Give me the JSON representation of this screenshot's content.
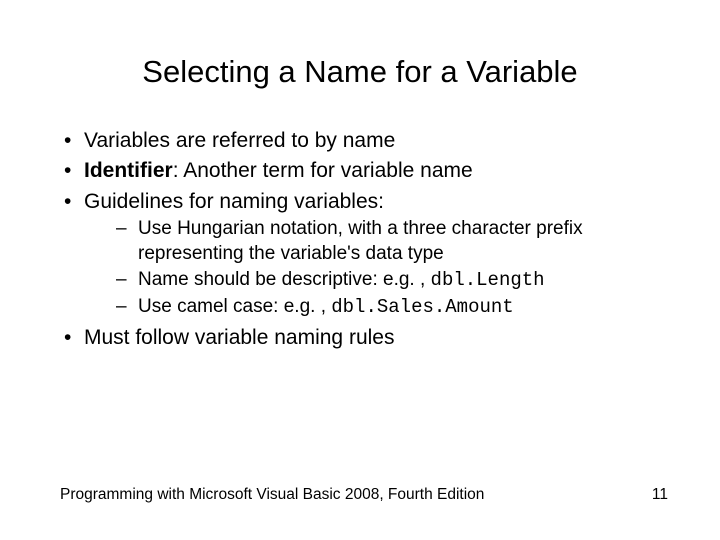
{
  "title": "Selecting a Name for a Variable",
  "bullets": {
    "b1": "Variables are referred to by name",
    "b2_bold": "Identifier",
    "b2_rest": ": Another term for variable name",
    "b3": "Guidelines for naming variables:",
    "s1": "Use Hungarian notation, with a three character prefix representing the variable's data type",
    "s2_text": "Name should be descriptive: e.g. , ",
    "s2_code": "dbl.Length",
    "s3_text": "Use camel case: e.g. , ",
    "s3_code": "dbl.Sales.Amount",
    "b4": "Must follow variable naming rules"
  },
  "footer": {
    "left": "Programming with Microsoft Visual Basic 2008, Fourth Edition",
    "right": "11"
  }
}
